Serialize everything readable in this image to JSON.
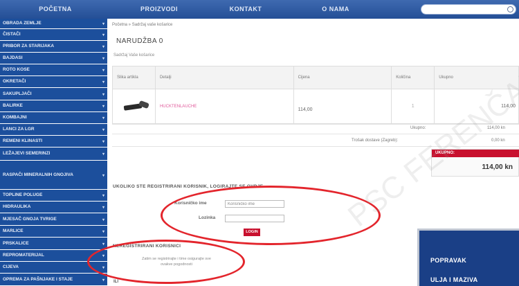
{
  "topnav": {
    "items": [
      "POČETNA",
      "PROIZVODI",
      "KONTAKT",
      "O NAMA"
    ],
    "search_placeholder": ""
  },
  "sidebar": {
    "items": [
      "OBRADA ZEMLJE",
      "ČISTAČI",
      "PRIBOR ZA STARIJAKA",
      "BAJDASI",
      "ROTO KOSE",
      "OKRETAČI",
      "SAKUPLJAČI",
      "BALIRKE",
      "KOMBAJNI",
      "LANCI ZA LGR",
      "REMENI KLINASTI",
      "LEŽAJEVI SEMERINZI",
      "RASPAČI MINERALNIH GNOJIVA",
      "TOPLINE POLUGE",
      "HIDRAULIKA",
      "MJESAČ GNOJA TVRIGE",
      "MARLICE",
      "PRSKALICE",
      "REPROMATERIJAL",
      "CIJEVA",
      "OPREMA ZA PAŠNJAKE I STAJE"
    ]
  },
  "breadcrumb": "Početna  »  Sadržaj vaše košarice",
  "page_title": "NARUDŽBA 0",
  "subtitle": "Sadržaj Vaše košarice",
  "table": {
    "headers": [
      "Slika artikla",
      "Detalji",
      "Cijena",
      "Količina",
      "Ukupno"
    ],
    "rows": [
      {
        "product": "HUCKTENLAUCHE",
        "price": "114,00",
        "qty": "1",
        "total": "114,00"
      }
    ]
  },
  "summary": {
    "subtotal_label": "Ukupno:",
    "subtotal_value": "114,00 kn",
    "shipping_label": "Trošak dostave (Zagreb):",
    "shipping_value": "0,00 kn",
    "total_label": "UKUPNO:",
    "total_value": "114,00 kn"
  },
  "login": {
    "section_title": "UKOLIKO STE REGISTRIRANI KORISNIK, LOGIRAJTE SE OVDJE",
    "username_label": "Korisničko ime",
    "username_value": "Korisničko ime",
    "password_label": "Lozinka",
    "password_value": "",
    "button_label": "LOGIN"
  },
  "unregistered": {
    "section_title": "NEREGISTRIRANI KORISNICI",
    "text": "Zatim se registrirajte i time osigurajte sve ovakve pogodnosti",
    "or": "ILI"
  },
  "promo": {
    "lines": [
      "POPRAVAK",
      "ULJA I MAZIVA"
    ]
  },
  "watermark": "PSC FERENČAK d.o.o.",
  "colors": {
    "nav_blue": "#244f96",
    "sidebar_blue": "#1c4f9c",
    "accent_red": "#c8102e",
    "highlight_red": "#e3252c",
    "link_pink": "#e0589a"
  }
}
